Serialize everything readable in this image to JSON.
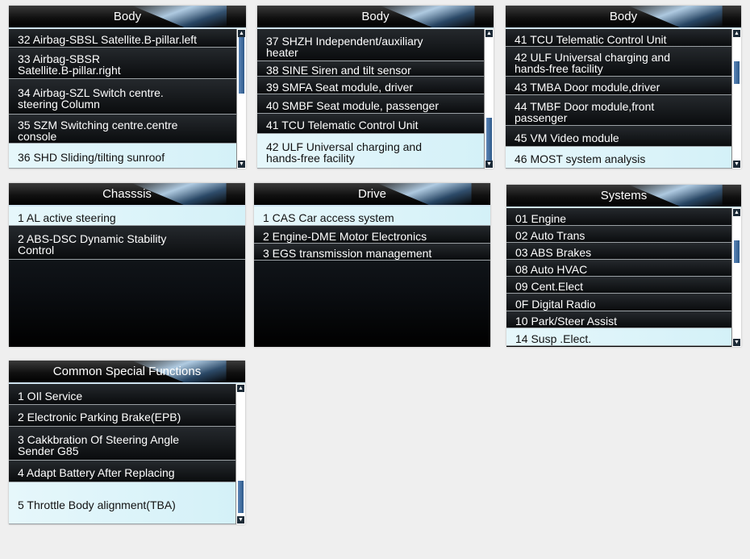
{
  "panels": [
    {
      "title": "Body",
      "selected": 4,
      "scrollbar": true,
      "items": [
        "32 Airbag-SBSL Satellite.B-pillar.left",
        "33 Airbag-SBSR\n     Satellite.B-pillar.right",
        "34 Airbag-SZL Switch centre.\n     steering Column",
        "35 SZM Switching centre.centre\n     console",
        "36 SHD Sliding/tilting sunroof"
      ]
    },
    {
      "title": "Body",
      "selected": 5,
      "scrollbar": true,
      "items": [
        "37 SHZH Independent/auxiliary\n     heater",
        "38 SINE Siren and tilt sensor",
        "39 SMFA  Seat module, driver",
        "40 SMBF  Seat module, passenger",
        "41 TCU Telematic Control Unit",
        "42 ULF Universal charging and\n     hands-free facility"
      ]
    },
    {
      "title": "Body",
      "selected": 5,
      "scrollbar": true,
      "items": [
        "41 TCU Telematic Control Unit",
        "42 ULF  Universal charging and\n     hands-free facility",
        "43 TMBA Door module,driver",
        "44 TMBF  Door module,front\n     passenger",
        "45 VM Video module",
        "46 MOST system analysis"
      ]
    },
    {
      "title": "Chasssis",
      "selected": 0,
      "scrollbar": false,
      "items": [
        "1  AL active steering",
        "2  ABS-DSC Dynamic Stability\n     Control"
      ]
    },
    {
      "title": "Drive",
      "selected": 0,
      "scrollbar": false,
      "items": [
        "1  CAS Car access system",
        "2  Engine-DME Motor Electronics",
        "3  EGS transmission management"
      ]
    },
    {
      "title": "Systems",
      "selected": 7,
      "scrollbar": true,
      "items": [
        "01 Engine",
        "02 Auto Trans",
        "03 ABS Brakes",
        "08 Auto HVAC",
        "09 Cent.Elect",
        "0F  Digital Radio",
        "10  Park/Steer Assist",
        "14 Susp .Elect."
      ]
    },
    {
      "title": "Common Special Functions",
      "selected": 4,
      "scrollbar": true,
      "items": [
        "1  OIl Service",
        "2  Electronic Parking Brake(EPB)",
        "3  Cakkbration Of Steering Angle\n     Sender G85",
        "4  Adapt Battery After Replacing",
        "5  Throttle Body alignment(TBA)"
      ]
    }
  ],
  "colors": {
    "selected_row": "#d4f1f8",
    "scroll_thumb": "#3f6c9e",
    "panel_bg": "#000000"
  }
}
